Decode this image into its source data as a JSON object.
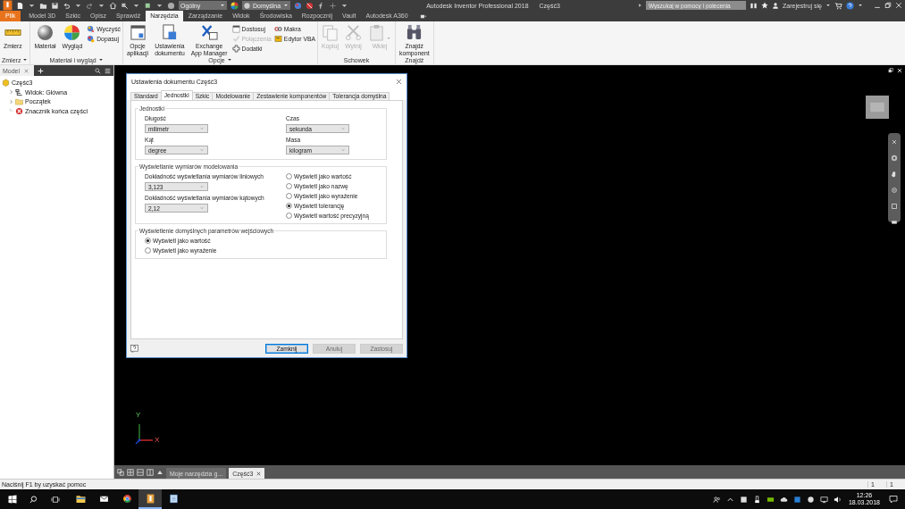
{
  "title_bar": {
    "style": "Ogólny",
    "appearance": "Domyślna",
    "app_title": "Autodesk Inventor Professional 2018",
    "document": "Część3",
    "search": {
      "placeholder": "Wyszukaj w pomocy i polecenia"
    },
    "sign_in": "Zarejestruj się"
  },
  "ribbon": {
    "tabs": [
      {
        "label": "Plik",
        "kind": "application-menu",
        "selected": false
      },
      {
        "label": "Model 3D",
        "kind": "tab",
        "selected": false
      },
      {
        "label": "Szkic",
        "kind": "tab",
        "selected": false
      },
      {
        "label": "Opisz",
        "kind": "tab",
        "selected": false
      },
      {
        "label": "Sprawdź",
        "kind": "tab",
        "selected": false
      },
      {
        "label": "Narzędzia",
        "kind": "tab",
        "selected": true
      },
      {
        "label": "Zarządzanie",
        "kind": "tab",
        "selected": false
      },
      {
        "label": "Widok",
        "kind": "tab",
        "selected": false
      },
      {
        "label": "Środowiska",
        "kind": "tab",
        "selected": false
      },
      {
        "label": "Rozpocznij",
        "kind": "tab",
        "selected": false
      },
      {
        "label": "Vault",
        "kind": "tab",
        "selected": false
      },
      {
        "label": "Autodesk A360",
        "kind": "tab",
        "selected": false
      }
    ],
    "groups": [
      {
        "label": "Zmierz",
        "menu": true,
        "items": [
          {
            "kind": "large",
            "label": "Zmierz",
            "disabled": false,
            "menu": false
          }
        ]
      },
      {
        "label": "Materiał i wygląd",
        "menu": true,
        "items": [
          {
            "kind": "large",
            "label": "Materiał",
            "disabled": false,
            "menu": false
          },
          {
            "kind": "large",
            "label": "Wygląd",
            "disabled": false,
            "menu": false
          },
          {
            "kind": "stack",
            "buttons": [
              {
                "label": "Wyczyść",
                "disabled": false
              },
              {
                "label": "Dopasuj",
                "disabled": false
              }
            ]
          }
        ]
      },
      {
        "label": "Opcje",
        "menu": true,
        "items": [
          {
            "kind": "large",
            "label": "Opcje\naplikacji",
            "disabled": false,
            "menu": false
          },
          {
            "kind": "large",
            "label": "Ustawienia\ndokumentu",
            "disabled": false,
            "menu": false
          },
          {
            "kind": "large",
            "label": "Exchange\nApp Manager",
            "disabled": false,
            "menu": false
          },
          {
            "kind": "stack",
            "buttons": [
              {
                "label": "Dostosuj",
                "disabled": false
              },
              {
                "label": "Połączenia",
                "disabled": true
              },
              {
                "label": "Dodatki",
                "disabled": false
              }
            ]
          },
          {
            "kind": "stack",
            "buttons": [
              {
                "label": "Makra",
                "disabled": false
              },
              {
                "label": "Edytor VBA",
                "disabled": false
              }
            ]
          }
        ]
      },
      {
        "label": "Schowek",
        "menu": false,
        "items": [
          {
            "kind": "large",
            "label": "Kopiuj",
            "disabled": true,
            "menu": false
          },
          {
            "kind": "large",
            "label": "Wytnij",
            "disabled": true,
            "menu": false
          },
          {
            "kind": "large",
            "label": "Wklej",
            "disabled": true,
            "menu": true
          }
        ]
      },
      {
        "label": "Znajdź",
        "menu": false,
        "items": [
          {
            "kind": "large",
            "label": "Znajdź\nkomponent",
            "disabled": false,
            "menu": false
          }
        ]
      }
    ]
  },
  "browser": {
    "tab": "Model",
    "tree": [
      {
        "label": "Część3",
        "children": [
          {
            "label": "Widok: Główna",
            "expandable": true
          },
          {
            "label": "Początek",
            "expandable": true
          },
          {
            "label": "Znacznik końca części",
            "expandable": false
          }
        ]
      }
    ]
  },
  "dialog": {
    "title": "Ustawienia dokumentu Część3",
    "tabs": [
      {
        "label": "Standard",
        "selected": false
      },
      {
        "label": "Jednostki",
        "selected": true
      },
      {
        "label": "Szkic",
        "selected": false
      },
      {
        "label": "Modelowanie",
        "selected": false
      },
      {
        "label": "Zestawienie komponentów",
        "selected": false
      },
      {
        "label": "Tolerancja domyślna",
        "selected": false
      }
    ],
    "sections": [
      {
        "title": "Jednostki",
        "kind": "grid",
        "fields": [
          {
            "label": "Długość",
            "value": "milimetr"
          },
          {
            "label": "Czas",
            "value": "sekunda"
          },
          {
            "label": "Kąt",
            "value": "degree"
          },
          {
            "label": "Masa",
            "value": "kilogram"
          }
        ]
      },
      {
        "title": "Wyświetlanie wymiarów modelowania",
        "kind": "split",
        "fields": [
          {
            "label": "Dokładność wyświetlania wymiarów liniowych",
            "value": "3,123"
          },
          {
            "label": "Dokładność wyświetlania wymiarów kątowych",
            "value": "2,12"
          }
        ],
        "options": [
          {
            "label": "Wyświetl jako wartość",
            "selected": false
          },
          {
            "label": "Wyświetl jako nazwę",
            "selected": false
          },
          {
            "label": "Wyświetl jako wyrażenie",
            "selected": false
          },
          {
            "label": "Wyświetl tolerancję",
            "selected": true
          },
          {
            "label": "Wyświetl wartość precyzyjną",
            "selected": false
          }
        ]
      },
      {
        "title": "Wyświetlenie domyślnych parametrów wejściowych",
        "kind": "radios",
        "options": [
          {
            "label": "Wyświetl jako wartość",
            "selected": true
          },
          {
            "label": "Wyświetl jako wyrażenie",
            "selected": false
          }
        ]
      }
    ],
    "buttons": [
      {
        "label": "Zamknij",
        "default": true,
        "disabled": false
      },
      {
        "label": "Anuluj",
        "default": false,
        "disabled": true
      },
      {
        "label": "Zastosuj",
        "default": false,
        "disabled": true
      }
    ]
  },
  "triad": {
    "y": "Y",
    "x": "X"
  },
  "document_tabs": [
    {
      "label": "Moje narzędzia g...",
      "selected": false
    },
    {
      "label": "Część3",
      "selected": true
    }
  ],
  "status_bar": {
    "hint": "Naciśnij F1 by uzyskać pomoc",
    "counters": [
      "1",
      "1"
    ]
  },
  "taskbar": {
    "apps": [
      {
        "selected": false
      },
      {
        "selected": false
      },
      {
        "selected": false
      },
      {
        "selected": true
      },
      {
        "selected": false
      }
    ],
    "time": "12:26",
    "date": "18.03.2018"
  }
}
